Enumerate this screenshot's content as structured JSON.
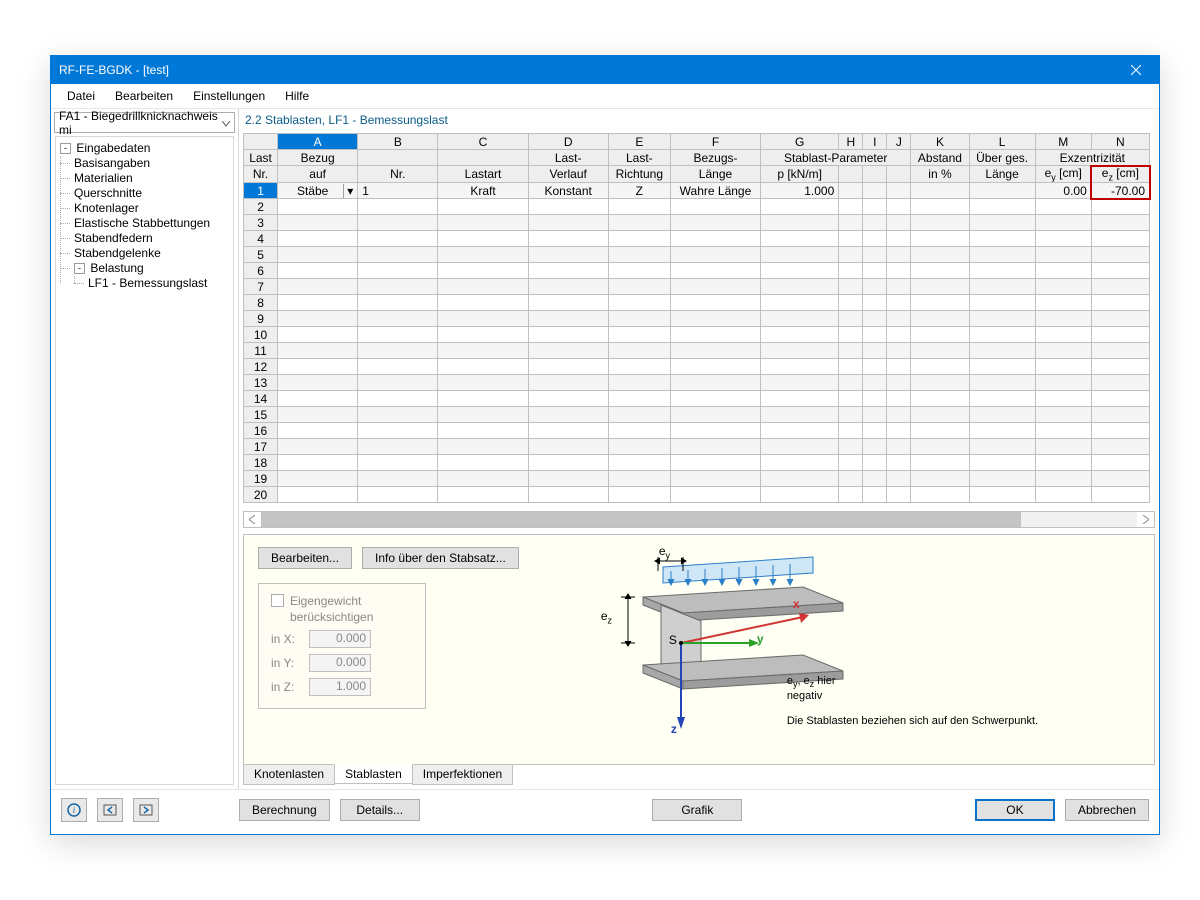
{
  "window": {
    "title": "RF-FE-BGDK - [test]"
  },
  "menubar": [
    "Datei",
    "Bearbeiten",
    "Einstellungen",
    "Hilfe"
  ],
  "fa_select": "FA1 - Biegedrillknicknachweis mi",
  "tree": {
    "root": {
      "exp": "-",
      "label": "Eingabedaten"
    },
    "children": [
      "Basisangaben",
      "Materialien",
      "Querschnitte",
      "Knotenlager",
      "Elastische Stabbettungen",
      "Stabendfedern",
      "Stabendgelenke"
    ],
    "belastung": {
      "exp": "-",
      "label": "Belastung"
    },
    "belastung_children": [
      "LF1 - Bemessungslast"
    ]
  },
  "main_title": "2.2 Stablasten, LF1 - Bemessungslast",
  "columns": {
    "letters": [
      "A",
      "B",
      "C",
      "D",
      "E",
      "F",
      "G",
      "H",
      "I",
      "J",
      "K",
      "L",
      "M",
      "N"
    ],
    "row1": [
      "Last",
      "Bezug",
      "",
      "",
      "Last-",
      "Last-",
      "Bezugs-",
      "Stablast-Parameter",
      "",
      "",
      "",
      "Abstand",
      "Über ges.",
      "Exzentrizität",
      ""
    ],
    "row2": [
      "Nr.",
      "auf",
      "Nr.",
      "Lastart",
      "Verlauf",
      "Richtung",
      "Länge",
      "p [kN/m]",
      "",
      "",
      "",
      "in %",
      "Länge",
      "e<sub>y</sub> [cm]",
      "e<sub>z</sub> [cm]"
    ]
  },
  "data_row": {
    "A_bezug": "Stäbe",
    "B_nr": "1",
    "C_lastart": "Kraft",
    "D_verlauf": "Konstant",
    "E_richtung": "Z",
    "F_laenge": "Wahre Länge",
    "G_p": "1.000",
    "H": "",
    "I": "",
    "J": "",
    "K": "",
    "L": "",
    "M_ey": "0.00",
    "N_ez": "-70.00"
  },
  "row_count": 20,
  "lower": {
    "buttons": [
      "Bearbeiten...",
      "Info über den Stabsatz..."
    ],
    "eigen_label1": "Eigengewicht",
    "eigen_label2": "berücksichtigen",
    "eigen_rows": [
      {
        "label": "in X:",
        "value": "0.000"
      },
      {
        "label": "in Y:",
        "value": "0.000"
      },
      {
        "label": "in Z:",
        "value": "1.000"
      }
    ],
    "diag_ey": "e",
    "diag_ey_sub": "y",
    "diag_ez": "e",
    "diag_ez_sub": "z",
    "diag_x": "x",
    "diag_y": "y",
    "diag_z": "z",
    "diag_s": "S",
    "diag_note1a": "e",
    "diag_note1a_sub": "y",
    "diag_note1b": ", e",
    "diag_note1b_sub": "z",
    "diag_note1c": " hier",
    "diag_note2": "negativ",
    "diag_text": "Die Stablasten beziehen sich auf den Schwerpunkt."
  },
  "tabs": [
    "Knotenlasten",
    "Stablasten",
    "Imperfektionen"
  ],
  "footer": {
    "berechnung": "Berechnung",
    "details": "Details...",
    "grafik": "Grafik",
    "ok": "OK",
    "abbrechen": "Abbrechen"
  }
}
